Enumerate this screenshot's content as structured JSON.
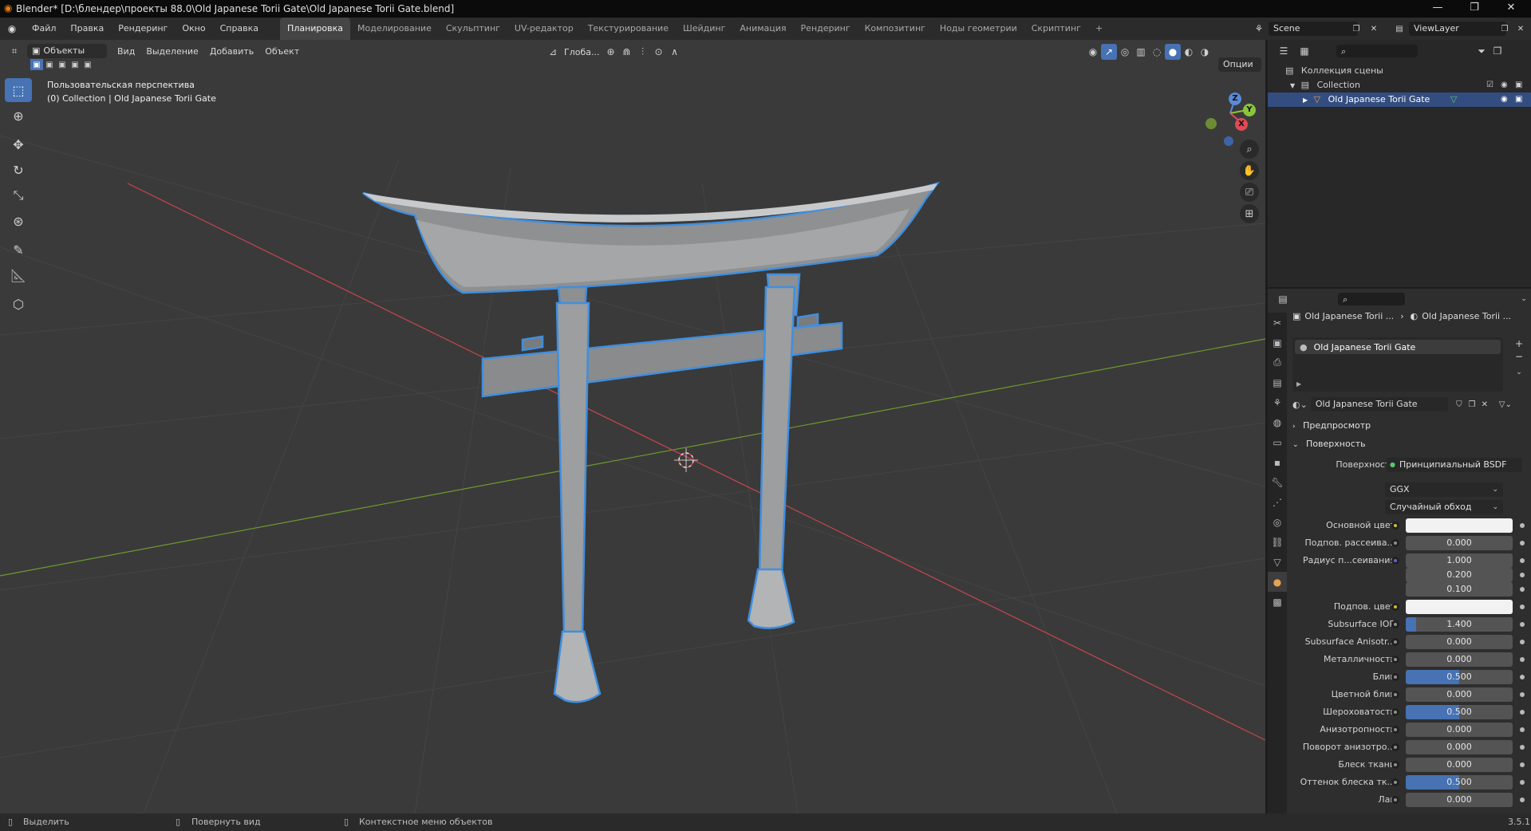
{
  "window": {
    "title": "Blender* [D:\\блендер\\проекты 88.0\\Old Japanese Torii Gate\\Old Japanese Torii Gate.blend]",
    "controls": [
      "—",
      "❐",
      "✕"
    ]
  },
  "menubar": {
    "menus": [
      "Файл",
      "Правка",
      "Рендеринг",
      "Окно",
      "Справка"
    ],
    "workspaces": [
      "Планировка",
      "Моделирование",
      "Скульптинг",
      "UV-редактор",
      "Текстурирование",
      "Шейдинг",
      "Анимация",
      "Рендеринг",
      "Композитинг",
      "Ноды геометрии",
      "Скриптинг"
    ],
    "active_workspace": "Планировка",
    "add_tab": "+",
    "scene": "Scene",
    "view_layer": "ViewLayer"
  },
  "viewport": {
    "mode": "Объекты",
    "menus": [
      "Вид",
      "Выделение",
      "Добавить",
      "Объект"
    ],
    "transform_orientation": "Глоба...",
    "options": "Опции",
    "perspective_label": "Пользовательская перспектива",
    "object_label": "(0) Collection | Old Japanese Torii Gate",
    "gizmo": {
      "x": "X",
      "y": "Y",
      "z": "Z"
    }
  },
  "outliner": {
    "rows": [
      {
        "label": "Коллекция сцены",
        "icon": "scene-collection-icon"
      },
      {
        "label": "Collection",
        "icon": "collection-icon"
      },
      {
        "label": "Old Japanese Torii Gate",
        "icon": "mesh-object-icon",
        "selected": true
      }
    ]
  },
  "properties": {
    "breadcrumb": [
      "Old Japanese Torii ...",
      "Old Japanese Torii ..."
    ],
    "material_slot": "Old Japanese Torii Gate",
    "material_name": "Old Japanese Torii Gate",
    "panels": {
      "preview": "Предпросмотр",
      "surface": "Поверхность"
    },
    "surface_label": "Поверхность",
    "surface_value": "Принципиальный BSDF",
    "distribution": "GGX",
    "subsurface_method": "Случайный обход",
    "rows": [
      {
        "label": "Основной цвет",
        "value": "",
        "type": "color",
        "dot": "yellow"
      },
      {
        "label": "Подпов. рассеива...",
        "value": "0.000",
        "fill": 0
      },
      {
        "label": "Радиус п...сеивания",
        "value": "1.000",
        "fill": 0,
        "dot": "purple"
      },
      {
        "label": "",
        "value": "0.200",
        "fill": 0,
        "nodot": true
      },
      {
        "label": "",
        "value": "0.100",
        "fill": 0,
        "nodot": true
      },
      {
        "label": "Подпов. цвет",
        "value": "",
        "type": "color",
        "dot": "yellow"
      },
      {
        "label": "Subsurface IOR",
        "value": "1.400",
        "fill": 0.1
      },
      {
        "label": "Subsurface Anisotr...",
        "value": "0.000",
        "fill": 0
      },
      {
        "label": "Металличность",
        "value": "0.000",
        "fill": 0
      },
      {
        "label": "Блик",
        "value": "0.500",
        "fill": 0.5
      },
      {
        "label": "Цветной блик",
        "value": "0.000",
        "fill": 0
      },
      {
        "label": "Шероховатость",
        "value": "0.500",
        "fill": 0.5
      },
      {
        "label": "Анизотропность",
        "value": "0.000",
        "fill": 0
      },
      {
        "label": "Поворот анизотро...",
        "value": "0.000",
        "fill": 0
      },
      {
        "label": "Блеск ткани",
        "value": "0.000",
        "fill": 0
      },
      {
        "label": "Оттенок блеска тк...",
        "value": "0.500",
        "fill": 0.5
      },
      {
        "label": "Лак",
        "value": "0.000",
        "fill": 0
      }
    ]
  },
  "statusbar": {
    "select": "Выделить",
    "rotate": "Повернуть вид",
    "context": "Контекстное меню объектов",
    "version": "3.5.1"
  },
  "colors": {
    "accent": "#4772b3",
    "selection_outline": "#3f8fe0",
    "viewport_bg": "#3a3a3a",
    "x_axis": "#c8464e",
    "y_axis": "#6e9a2e"
  }
}
